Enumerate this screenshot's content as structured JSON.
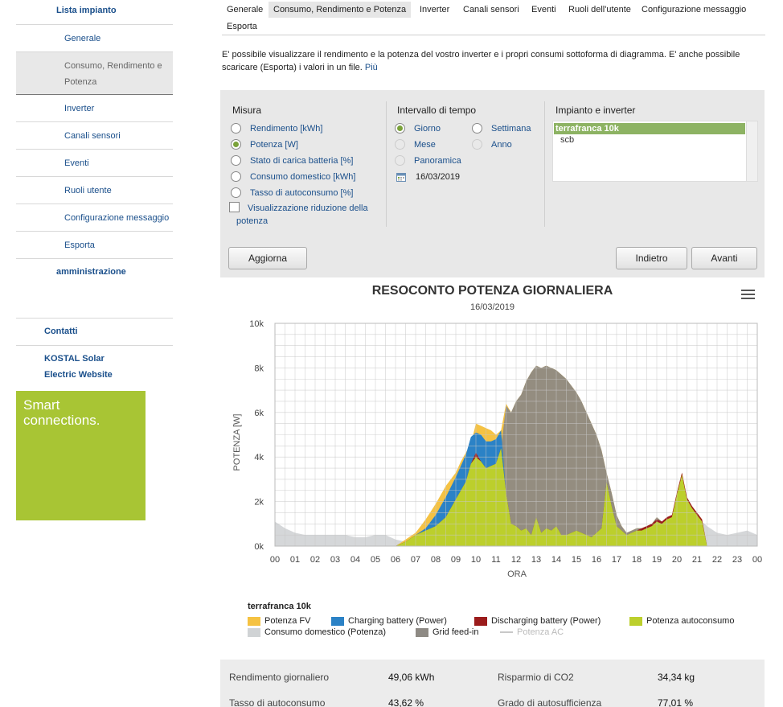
{
  "sidebar": {
    "plant_list": "Lista impianto",
    "items": [
      {
        "label": "Generale"
      },
      {
        "label": "Consumo, Rendimento e Potenza"
      },
      {
        "label": "Inverter"
      },
      {
        "label": "Canali sensori"
      },
      {
        "label": "Eventi"
      },
      {
        "label": "Ruoli utente"
      },
      {
        "label": "Configurazione messaggio"
      },
      {
        "label": "Esporta"
      }
    ],
    "admin": "amministrazione",
    "contacts": "Contatti",
    "website": "KOSTAL Solar Electric Website"
  },
  "promo": {
    "line1": "Smart",
    "line2": "connections."
  },
  "tabs": [
    {
      "label": "Generale"
    },
    {
      "label": "Consumo, Rendimento e Potenza"
    },
    {
      "label": "Inverter"
    },
    {
      "label": "Canali sensori"
    },
    {
      "label": "Eventi"
    },
    {
      "label": "Ruoli dell'utente"
    },
    {
      "label": "Configurazione messaggio"
    },
    {
      "label": "Esporta"
    }
  ],
  "intro": {
    "text": "E' possibile visualizzare il rendimento e la potenza del vostro inverter e i propri consumi sottoforma di diagramma. E' anche possibile scaricare (Esporta) i valori in un file.",
    "more": "Più"
  },
  "filters": {
    "measure_title": "Misura",
    "measures": [
      {
        "label": "Rendimento [kWh]"
      },
      {
        "label": "Potenza [W]"
      },
      {
        "label": "Stato di carica batteria [%]"
      },
      {
        "label": "Consumo domestico [kWh]"
      },
      {
        "label": "Tasso di autoconsumo [%]"
      }
    ],
    "power_reduction_line1": "Visualizzazione riduzione della",
    "power_reduction_line2": "potenza",
    "interval_title": "Intervallo di tempo",
    "intervals": {
      "day": "Giorno",
      "week": "Settimana",
      "month": "Mese",
      "year": "Anno",
      "overview": "Panoramica"
    },
    "date": "16/03/2019",
    "plant_title": "Impianto e inverter",
    "plants": [
      {
        "label": "terrafranca 10k"
      },
      {
        "label": "scb"
      }
    ],
    "update_button": "Aggiorna",
    "back_button": "Indietro",
    "forward_button": "Avanti"
  },
  "colors": {
    "pv": "#f5c242",
    "charging": "#2b82c6",
    "discharging": "#9b1c1c",
    "self_consumption": "#bccf2c",
    "household": "#d0d3d5",
    "feedin": "#8e8a84",
    "ac": "#c8c8c8"
  },
  "chart_data": {
    "type": "area",
    "title": "RESOCONTO POTENZA GIORNALIERA",
    "subtitle": "16/03/2019",
    "xlabel": "ORA",
    "ylabel": "POTENZA [W]",
    "ylim": [
      0,
      10000
    ],
    "yticks": [
      "0k",
      "2k",
      "4k",
      "6k",
      "8k",
      "10k"
    ],
    "xticks": [
      "00",
      "01",
      "02",
      "03",
      "04",
      "05",
      "06",
      "07",
      "08",
      "09",
      "10",
      "11",
      "12",
      "13",
      "14",
      "15",
      "16",
      "17",
      "18",
      "19",
      "20",
      "21",
      "22",
      "23",
      "00"
    ],
    "grid": true,
    "legend_title": "terrafranca 10k",
    "x": [
      0,
      0.5,
      1,
      1.5,
      2,
      2.5,
      3,
      3.5,
      4,
      4.5,
      5,
      5.5,
      6,
      6.5,
      7,
      7.5,
      8,
      8.5,
      9,
      9.25,
      9.5,
      9.75,
      10,
      10.25,
      10.5,
      10.75,
      11,
      11.25,
      11.5,
      11.75,
      12,
      12.25,
      12.5,
      12.75,
      13,
      13.25,
      13.5,
      13.75,
      14,
      14.25,
      14.5,
      14.75,
      15,
      15.25,
      15.5,
      15.75,
      16,
      16.25,
      16.5,
      16.75,
      17,
      17.25,
      17.5,
      17.75,
      18,
      18.25,
      18.5,
      18.75,
      19,
      19.25,
      19.5,
      19.75,
      20,
      20.25,
      20.5,
      20.75,
      21,
      21.25,
      21.5,
      22,
      22.5,
      23,
      23.5,
      24
    ],
    "series": [
      {
        "name": "Potenza FV",
        "values": [
          0,
          0,
          0,
          0,
          0,
          0,
          0,
          0,
          0,
          0,
          0,
          0,
          0,
          300,
          600,
          1200,
          1900,
          2700,
          3300,
          3800,
          4200,
          4600,
          5500,
          5400,
          5300,
          5200,
          5000,
          5200,
          6400,
          6000,
          6500,
          6800,
          7400,
          7800,
          8100,
          8000,
          8100,
          8000,
          7900,
          7700,
          7500,
          7200,
          6900,
          6500,
          6000,
          5500,
          5000,
          4300,
          3300,
          2400,
          1400,
          900,
          600,
          700,
          800,
          800,
          900,
          1000,
          1300,
          1100,
          1200,
          1300,
          2400,
          3300,
          2200,
          1700,
          1500,
          1200,
          0,
          0,
          0,
          0,
          0,
          0
        ]
      },
      {
        "name": "Charging battery (Power)",
        "values": [
          0,
          0,
          0,
          0,
          0,
          0,
          0,
          0,
          0,
          0,
          0,
          0,
          0,
          0,
          0,
          100,
          500,
          900,
          1000,
          1100,
          1200,
          1200,
          1100,
          1200,
          1200,
          1100,
          1100,
          800,
          0,
          0,
          0,
          0,
          0,
          0,
          0,
          0,
          0,
          0,
          0,
          0,
          0,
          0,
          0,
          0,
          0,
          0,
          0,
          0,
          0,
          0,
          0,
          0,
          0,
          0,
          0,
          0,
          0,
          0,
          0,
          0,
          0,
          0,
          0,
          0,
          0,
          0,
          0,
          0,
          0,
          0,
          0,
          0,
          0,
          0
        ]
      },
      {
        "name": "Discharging battery (Power)",
        "values": [
          0,
          0,
          0,
          0,
          0,
          0,
          0,
          0,
          0,
          0,
          0,
          0,
          0,
          0,
          0,
          0,
          0,
          0,
          0,
          0,
          0,
          0,
          200,
          0,
          0,
          0,
          0,
          0,
          0,
          0,
          0,
          0,
          0,
          0,
          0,
          0,
          0,
          0,
          0,
          0,
          0,
          0,
          0,
          0,
          0,
          0,
          0,
          0,
          0,
          0,
          0,
          0,
          0,
          0,
          0,
          100,
          100,
          100,
          100,
          100,
          100,
          100,
          100,
          100,
          100,
          100,
          100,
          100,
          0,
          0,
          0,
          0,
          0,
          0
        ]
      },
      {
        "name": "Potenza autoconsumo",
        "values": [
          0,
          0,
          0,
          0,
          0,
          0,
          0,
          0,
          0,
          0,
          0,
          0,
          0,
          200,
          500,
          700,
          900,
          1300,
          2100,
          2500,
          2900,
          3700,
          4000,
          3800,
          3500,
          3600,
          3700,
          4400,
          2400,
          1000,
          900,
          700,
          800,
          500,
          1300,
          600,
          800,
          700,
          900,
          500,
          500,
          600,
          700,
          600,
          500,
          400,
          600,
          800,
          2900,
          1800,
          900,
          700,
          500,
          600,
          700,
          700,
          800,
          900,
          1100,
          1000,
          1200,
          1300,
          2300,
          3200,
          2100,
          1700,
          1400,
          1100,
          0,
          0,
          0,
          0,
          0,
          0
        ]
      },
      {
        "name": "Consumo domestico (Potenza)",
        "values": [
          1100,
          800,
          600,
          500,
          500,
          500,
          500,
          500,
          400,
          400,
          500,
          500,
          300,
          200,
          500,
          700,
          900,
          1300,
          2100,
          2500,
          2900,
          3700,
          4000,
          3800,
          3500,
          3600,
          3700,
          4400,
          2400,
          1000,
          900,
          700,
          800,
          500,
          1300,
          600,
          800,
          700,
          900,
          500,
          500,
          600,
          700,
          600,
          500,
          400,
          600,
          800,
          2900,
          1800,
          900,
          700,
          500,
          600,
          700,
          700,
          800,
          900,
          1100,
          1000,
          1200,
          1300,
          2300,
          3200,
          2100,
          1700,
          1400,
          1100,
          900,
          600,
          500,
          600,
          700,
          500
        ]
      },
      {
        "name": "Grid feed-in",
        "values": [
          0,
          0,
          0,
          0,
          0,
          0,
          0,
          0,
          0,
          0,
          0,
          0,
          0,
          0,
          0,
          0,
          0,
          0,
          0,
          0,
          0,
          0,
          0,
          0,
          0,
          0,
          0,
          0,
          3900,
          5000,
          5600,
          6100,
          6600,
          7300,
          6800,
          7400,
          7300,
          7300,
          7000,
          7200,
          7000,
          6600,
          6200,
          5900,
          5500,
          5100,
          4400,
          3500,
          400,
          600,
          500,
          200,
          100,
          100,
          100,
          100,
          100,
          100,
          200,
          100,
          0,
          0,
          0,
          0,
          0,
          0,
          0,
          0,
          0,
          0,
          0,
          0,
          0,
          0
        ]
      },
      {
        "name": "Potenza AC",
        "values": [
          0,
          0,
          0,
          0,
          0,
          0,
          0,
          0,
          0,
          0,
          0,
          0,
          0,
          0,
          0,
          0,
          0,
          0,
          0,
          0,
          0,
          0,
          0,
          0,
          0,
          0,
          0,
          0,
          0,
          0,
          0,
          0,
          0,
          0,
          0,
          0,
          0,
          0,
          0,
          0,
          0,
          0,
          0,
          0,
          0,
          0,
          0,
          0,
          0,
          0,
          0,
          0,
          0,
          0,
          0,
          0,
          0,
          0,
          0,
          0,
          0,
          0,
          0,
          0,
          0,
          0,
          0,
          0,
          0,
          0,
          0,
          0,
          0,
          0
        ]
      }
    ]
  },
  "stats": [
    {
      "label": "Rendimento giornaliero",
      "value": "49,06 kWh"
    },
    {
      "label": "Risparmio di CO2",
      "value": "34,34 kg"
    },
    {
      "label": "Tasso di autoconsumo",
      "value": "43,62 %"
    },
    {
      "label": "Grado di autosufficienza",
      "value": "77,01 %"
    }
  ]
}
